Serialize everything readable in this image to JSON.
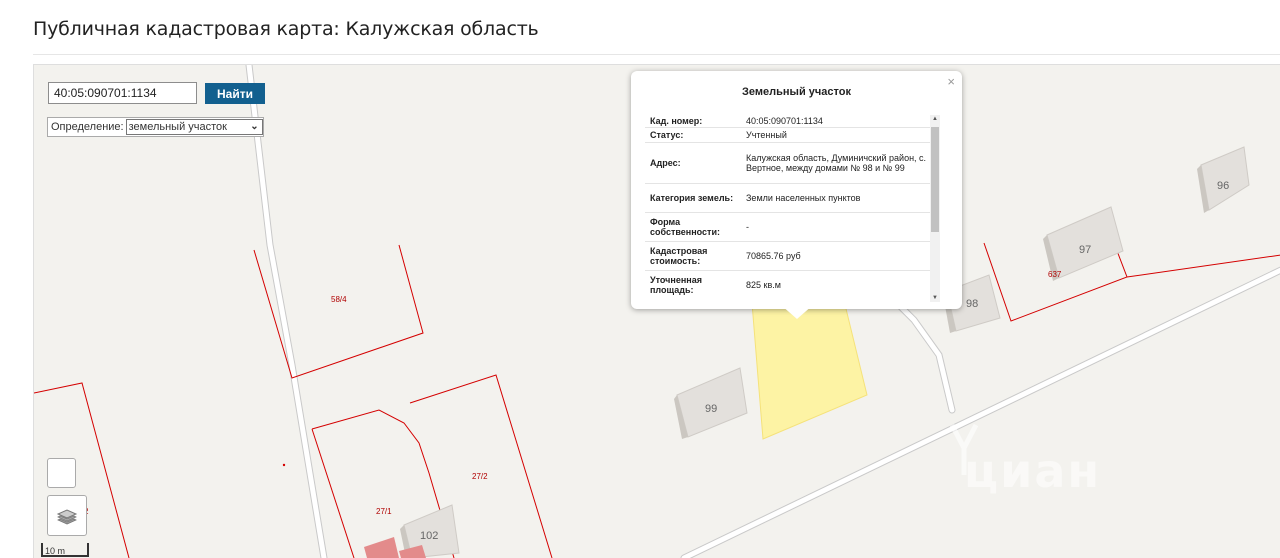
{
  "page_title": "Публичная кадастровая карта: Калужская область",
  "search": {
    "value": "40:05:090701:1134",
    "button_label": "Найти"
  },
  "definition": {
    "label": "Определение:",
    "selected": "земельный участок"
  },
  "popup": {
    "title": "Земельный участок",
    "close": "×",
    "rows": [
      {
        "key": "Кад. номер:",
        "value": "40:05:090701:1134"
      },
      {
        "key": "Статус:",
        "value": "Учтенный"
      },
      {
        "key": "Адрес:",
        "value": "Калужская область, Думиничский район, с. Вертное, между домами № 98 и № 99"
      },
      {
        "key": "Категория земель:",
        "value": "Земли населенных пунктов"
      },
      {
        "key": "Форма собственности:",
        "value": "-"
      },
      {
        "key": "Кадастровая стоимость:",
        "value": "70865.76 руб"
      },
      {
        "key": "Уточненная площадь:",
        "value": "825 кв.м"
      }
    ]
  },
  "map": {
    "house_numbers": [
      "96",
      "97",
      "98",
      "99",
      "102"
    ],
    "parcel_labels": [
      "58/4",
      "637",
      "27/1",
      "27/2",
      "2"
    ],
    "scale_label": "10 m",
    "watermark": "циан",
    "colors": {
      "background": "#f3f2ee",
      "parcel_border": "#d40000",
      "selected_parcel": "#fdf3a4",
      "house": "#e3e0dc",
      "road": "#ffffff",
      "accent_button": "#12608f"
    },
    "icons": [
      "layers-icon",
      "cian-logo-icon"
    ]
  }
}
